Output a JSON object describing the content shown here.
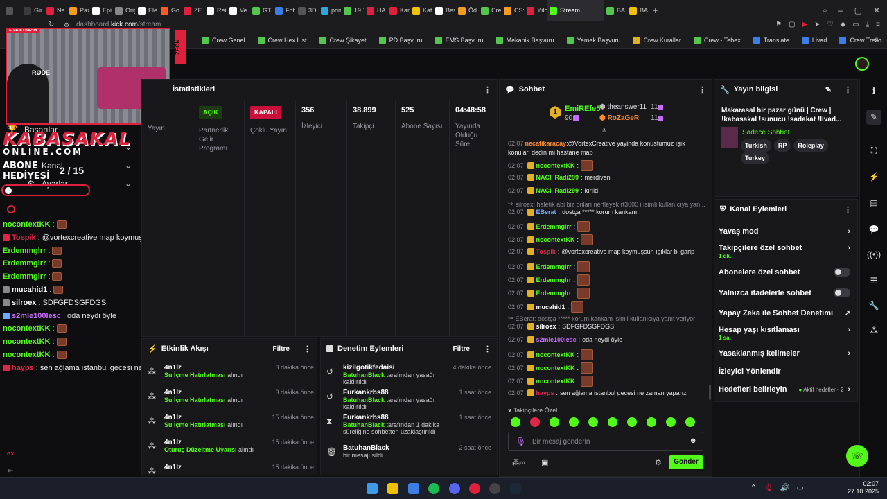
{
  "browser": {
    "tabs": [
      {
        "label": "Gir",
        "color": "#3b3b3b"
      },
      {
        "label": "Ne",
        "color": "#e0203c"
      },
      {
        "label": "Paz",
        "color": "#f59a23"
      },
      {
        "label": "Epi",
        "color": "#ffffff"
      },
      {
        "label": "Orig",
        "color": "#888888"
      },
      {
        "label": "Ele",
        "color": "#ffffff"
      },
      {
        "label": "Go",
        "color": "#ff5a1f"
      },
      {
        "label": "ZE",
        "color": "#e0203c"
      },
      {
        "label": "Rei",
        "color": "#ffffff"
      },
      {
        "label": "Ve",
        "color": "#ffffff"
      },
      {
        "label": "GT/",
        "color": "#53c64d"
      },
      {
        "label": "Fot",
        "color": "#3d7ee6"
      },
      {
        "label": "3D",
        "color": "#555555"
      },
      {
        "label": "prin",
        "color": "#2aa8e0"
      },
      {
        "label": "19.1",
        "color": "#53c64d"
      },
      {
        "label": "HA",
        "color": "#e0203c"
      },
      {
        "label": "Kar",
        "color": "#e0203c"
      },
      {
        "label": "Kat",
        "color": "#f2c200"
      },
      {
        "label": "Bes",
        "color": "#ffffff"
      },
      {
        "label": "Öd",
        "color": "#f59a23"
      },
      {
        "label": "Cre",
        "color": "#53c64d"
      },
      {
        "label": "CS:",
        "color": "#f59a23"
      },
      {
        "label": "Yılc",
        "color": "#e0203c"
      }
    ],
    "active_tab": "Stream",
    "extra_tabs": [
      "BA",
      "BA"
    ],
    "url_prefix": "dashboard.",
    "url_domain": "kick.com",
    "url_path": "/stream",
    "bookmarks": [
      {
        "label": "Crew Genel",
        "color": "g"
      },
      {
        "label": "Crew Hex List",
        "color": "g"
      },
      {
        "label": "Crew Şikayet",
        "color": "g"
      },
      {
        "label": "PD Başvuru",
        "color": "g"
      },
      {
        "label": "EMS Başvuru",
        "color": "g"
      },
      {
        "label": "Mekanik Başvuru",
        "color": "g"
      },
      {
        "label": "Yemek Başvuru",
        "color": "g"
      },
      {
        "label": "Crew Kurallar",
        "color": "y"
      },
      {
        "label": "Crew - Tebex",
        "color": "g"
      },
      {
        "label": "Translate",
        "color": "b"
      },
      {
        "label": "Livad",
        "color": "b"
      },
      {
        "label": "Crew Trello",
        "color": "b"
      }
    ]
  },
  "overlay": {
    "live": "LIVE STREAM",
    "cam_label": "RØDE",
    "logo1": "KABASAKAL",
    "logo2": "ONLINE.COM",
    "gift1": "ABONE",
    "gift2": "HEDİYESİ",
    "gift_count": "2 / 15",
    "side_tag": "ZEON",
    "gx": "GX"
  },
  "leftnav": {
    "items": [
      {
        "label": "Başarılar"
      },
      {
        "label": "Kanal"
      },
      {
        "label": "Ayarlar"
      }
    ]
  },
  "overlay_chat": [
    {
      "user": "nocontextKK",
      "sep": ":",
      "text": "",
      "color": "g",
      "emote": true
    },
    {
      "user": "Tospik",
      "sep": ":",
      "text": "@vortexcreative map koymuşsun ışıklar bi garip",
      "color": "r",
      "emote": false
    },
    {
      "user": "Erdemmglrr",
      "sep": ":",
      "text": "",
      "color": "g",
      "emote": true
    },
    {
      "user": "Erdemmglrr",
      "sep": ":",
      "text": "",
      "color": "g",
      "emote": true
    },
    {
      "user": "Erdemmglrr",
      "sep": ":",
      "text": "",
      "color": "g",
      "emote": true
    },
    {
      "user": "mucahid1",
      "sep": ":",
      "text": "",
      "color": "w",
      "emote": true
    },
    {
      "user": "silroex",
      "sep": ":",
      "text": "SDFGFDSGFDGS",
      "color": "w",
      "emote": false
    },
    {
      "user": "s2mle100lesc",
      "sep": ":",
      "text": "oda neydi öyle",
      "color": "p",
      "emote": false
    },
    {
      "user": "nocontextKK",
      "sep": ":",
      "text": "",
      "color": "g",
      "emote": true
    },
    {
      "user": "nocontextKK",
      "sep": ":",
      "text": "",
      "color": "g",
      "emote": true
    },
    {
      "user": "nocontextKK",
      "sep": ":",
      "text": "",
      "color": "g",
      "emote": true
    },
    {
      "user": "hayps",
      "sep": ":",
      "text": "sen ağlama istanbul gecesi ne zaman yaparız",
      "color": "r",
      "emote": false
    }
  ],
  "stats": {
    "title": "İstatistikleri",
    "cols": [
      {
        "pill": "",
        "label": "Yayın",
        "value": ""
      },
      {
        "pill": "AÇIK",
        "pill_type": "open",
        "label": "Partnerlik Gelir Programı",
        "value": ""
      },
      {
        "pill": "KAPALI",
        "pill_type": "closed",
        "label": "Çoklu Yayın",
        "value": ""
      },
      {
        "pill": "",
        "label": "İzleyici",
        "value": "356"
      },
      {
        "pill": "",
        "label": "Takipçi",
        "value": "38.899"
      },
      {
        "pill": "",
        "label": "Abone Sayısı",
        "value": "525"
      },
      {
        "pill": "",
        "label": "Yayında Olduğu Süre",
        "value": "04:48:58"
      }
    ]
  },
  "activity": {
    "title": "Etkinlik Akışı",
    "filter": "Filtre",
    "rows": [
      {
        "user": "4n1lz",
        "reward": "Su İçme Hatırlatması",
        "suffix": "alındı",
        "time": "3 dakika önce"
      },
      {
        "user": "4n1lz",
        "reward": "Su İçme Hatırlatması",
        "suffix": "alındı",
        "time": "3 dakika önce"
      },
      {
        "user": "4n1lz",
        "reward": "Su İçme Hatırlatması",
        "suffix": "alındı",
        "time": "15 dakika önce"
      },
      {
        "user": "4n1lz",
        "reward": "Oturuş Düzeltme Uyarısı",
        "suffix": "alındı",
        "time": "15 dakika önce"
      },
      {
        "user": "4n1lz",
        "reward": "",
        "suffix": "",
        "time": "15 dakika önce"
      }
    ]
  },
  "moderation": {
    "title": "Denetim Eylemleri",
    "filter": "Filtre",
    "rows": [
      {
        "user": "kizilgotikfedaisi",
        "mod": "BatuhanBlack",
        "text": "tarafından yasağı kaldırıldı",
        "time": "4 dakika önce",
        "icon": "↺"
      },
      {
        "user": "Furkankrbs88",
        "mod": "BatuhanBlack",
        "text": "tarafından yasağı kaldırıldı",
        "time": "1 saat önce",
        "icon": "↺"
      },
      {
        "user": "Furkankrbs88",
        "mod": "BatuhanBlack",
        "text": "tarafından 1 dakika süreliğine sohbetten uzaklaştırıldı",
        "time": "1 saat önce",
        "icon": "⧗"
      },
      {
        "user": "BatuhanBlack",
        "mod": "",
        "text": "bir mesajı sildi",
        "time": "2 saat önce",
        "icon": "🗑"
      }
    ]
  },
  "chat": {
    "title": "Sohbet",
    "top": [
      {
        "rank": "1",
        "name": "EmiREfe5",
        "count": "90"
      },
      {
        "name": "theanswer11",
        "count": "11"
      },
      {
        "name": "RoZaGeR",
        "count": "11"
      }
    ],
    "messages": [
      {
        "ts": "02:07",
        "user": "necatikaracay",
        "color": "o",
        "text": "@VortexCreative yayinda konustumuz ışık konulari dedin mi hastane map",
        "type": "msg"
      },
      {
        "ts": "02:07",
        "user": "nocontextKK",
        "color": "g",
        "text": "",
        "type": "emote"
      },
      {
        "ts": "02:07",
        "user": "NACI_Radi299",
        "color": "g",
        "text": "merdiven",
        "type": "msg"
      },
      {
        "ts": "02:07",
        "user": "NACI_Radi299",
        "color": "g",
        "text": "kırıldı",
        "type": "msg"
      },
      {
        "ts": "",
        "user": "",
        "color": "",
        "text": "silroex: haletik abi biz onları nerfleyek rt3000 i isimli kullanıcıya yan...",
        "type": "sys"
      },
      {
        "ts": "02:07",
        "user": "EBerat",
        "color": "b",
        "text": "dostça ***** korum kankam",
        "type": "msg"
      },
      {
        "ts": "02:07",
        "user": "Erdemmglrr",
        "color": "g",
        "text": "",
        "type": "emote"
      },
      {
        "ts": "02:07",
        "user": "nocontextKK",
        "color": "g",
        "text": "",
        "type": "emote"
      },
      {
        "ts": "02:07",
        "user": "Tospik",
        "color": "r",
        "text": "@vortexcreative map koymuşsun ışıklar bi garip",
        "type": "msg"
      },
      {
        "ts": "02:07",
        "user": "Erdemmglrr",
        "color": "g",
        "text": "",
        "type": "emote"
      },
      {
        "ts": "02:07",
        "user": "Erdemmglrr",
        "color": "g",
        "text": "",
        "type": "emote"
      },
      {
        "ts": "02:07",
        "user": "Erdemmglrr",
        "color": "g",
        "text": "",
        "type": "emote"
      },
      {
        "ts": "02:07",
        "user": "mucahid1",
        "color": "w",
        "text": "",
        "type": "emote"
      },
      {
        "ts": "",
        "user": "",
        "color": "",
        "text": "EBerat: dostça ***** korum kankam isimli kullanıcıya yanıt veriyor",
        "type": "sys"
      },
      {
        "ts": "02:07",
        "user": "silroex",
        "color": "w",
        "text": "SDFGFDSGFDGS",
        "type": "msg"
      },
      {
        "ts": "02:07",
        "user": "s2mle100lesc",
        "color": "p",
        "text": "oda neydi öyle",
        "type": "msg"
      },
      {
        "ts": "02:07",
        "user": "nocontextKK",
        "color": "g",
        "text": "",
        "type": "emote"
      },
      {
        "ts": "02:07",
        "user": "nocontextKK",
        "color": "g",
        "text": "",
        "type": "emote"
      },
      {
        "ts": "02:07",
        "user": "nocontextKK",
        "color": "g",
        "text": "",
        "type": "emote"
      },
      {
        "ts": "02:07",
        "user": "hayps",
        "color": "r",
        "text": "sen ağlama istanbul gecesi ne zaman yaparız",
        "type": "msg"
      }
    ],
    "followers_only": "Takipçilere Özel",
    "input_placeholder": "Bir mesaj gönderin",
    "send": "Gönder"
  },
  "stream_info": {
    "title": "Yayın bilgisi",
    "stream_title": "Makarasal bir pazar günü | Crew | !kabasakal !sunucu !sadakat !livad...",
    "category": "Sadece Sohbet",
    "tags": [
      "Turkish",
      "RP",
      "Roleplay",
      "Turkey"
    ]
  },
  "channel_actions": {
    "title": "Kanal Eylemleri",
    "items": [
      {
        "label": "Yavaş mod",
        "sub": "",
        "control": "chevron"
      },
      {
        "label": "Takipçilere özel sohbet",
        "sub": "1 dk.",
        "control": "chevron"
      },
      {
        "label": "Abonelere özel sohbet",
        "sub": "",
        "control": "toggle"
      },
      {
        "label": "Yalnızca ifadelerle sohbet",
        "sub": "",
        "control": "toggle"
      },
      {
        "label": "Yapay Zeka ile Sohbet Denetimi",
        "sub": "",
        "control": "ext"
      },
      {
        "label": "Hesap yaşı kısıtlaması",
        "sub": "1 sa.",
        "control": "chevron"
      },
      {
        "label": "Yasaklanmış kelimeler",
        "sub": "",
        "control": "chevron"
      },
      {
        "label": "İzleyici Yönlendir",
        "sub": "",
        "control": "none"
      },
      {
        "label": "Hedefleri belirleyin",
        "sub": "",
        "control": "goal"
      }
    ],
    "goal_text": "Aktif hedefler - 2"
  },
  "taskbar": {
    "time": "02:07",
    "date": "27.10.2025"
  }
}
